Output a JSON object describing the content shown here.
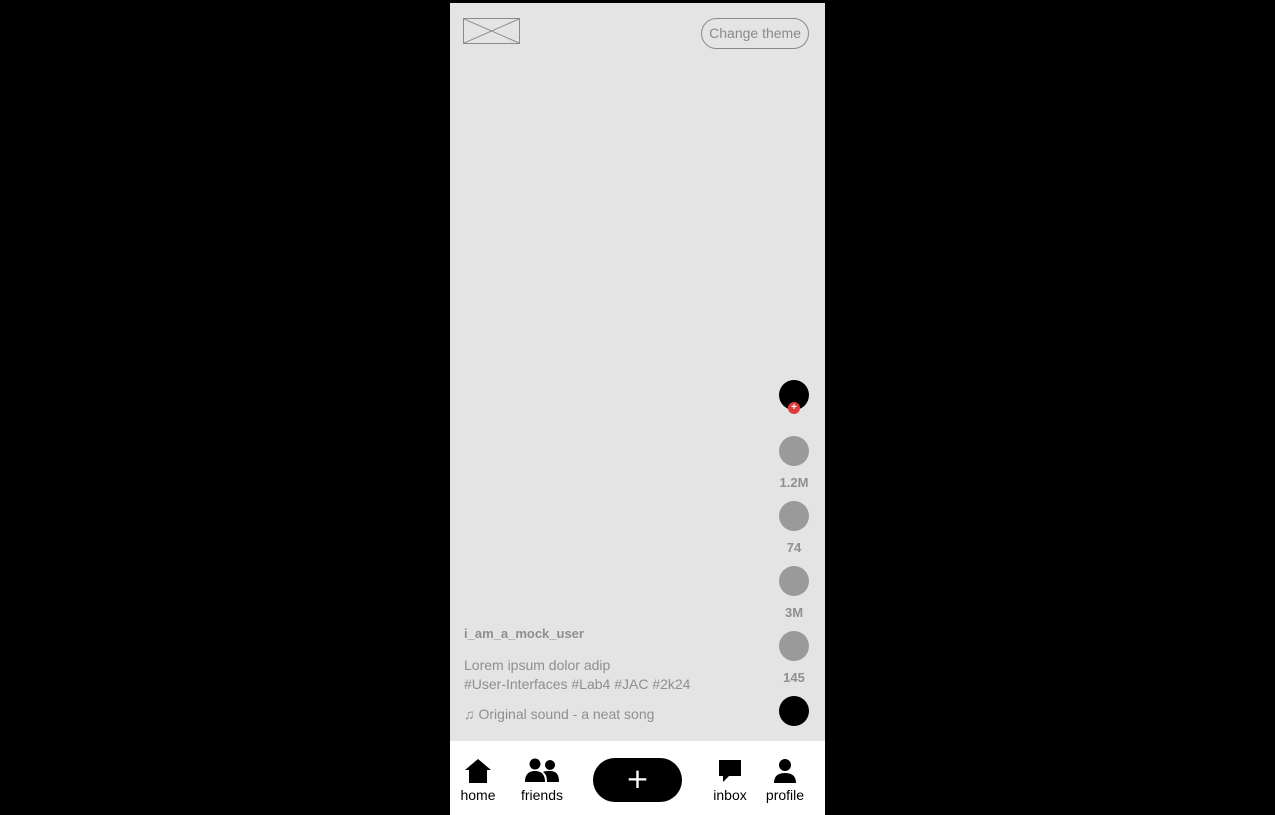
{
  "header": {
    "logo_icon": "image-placeholder-icon",
    "theme_button_label": "Change theme"
  },
  "actions": {
    "creator_avatar_icon": "avatar-icon",
    "follow_badge": "+",
    "items": [
      {
        "icon": "like-icon",
        "count": "1.2M"
      },
      {
        "icon": "comment-icon",
        "count": "74"
      },
      {
        "icon": "bookmark-icon",
        "count": "3M"
      },
      {
        "icon": "share-icon",
        "count": "145"
      }
    ],
    "sound_disc_icon": "music-disc-icon"
  },
  "caption": {
    "username": "i_am_a_mock_user",
    "description_line1": "Lorem ipsum dolor adip",
    "description_line2": "#User-Interfaces #Lab4 #JAC #2k24",
    "sound_icon": "♫",
    "sound_text": "Original sound - a neat song"
  },
  "nav": {
    "home": {
      "icon": "home-icon",
      "label": "home"
    },
    "friends": {
      "icon": "friends-icon",
      "label": "friends"
    },
    "add": {
      "icon": "plus-icon",
      "label": "+"
    },
    "inbox": {
      "icon": "inbox-icon",
      "label": "inbox"
    },
    "profile": {
      "icon": "profile-icon",
      "label": "profile"
    }
  },
  "colors": {
    "background": "#000000",
    "screen": "#e4e4e4",
    "muted_text": "#8f8f8f",
    "action_circle": "#9a9a9a",
    "follow_badge": "#e03b3b",
    "navbar": "#ffffff"
  }
}
